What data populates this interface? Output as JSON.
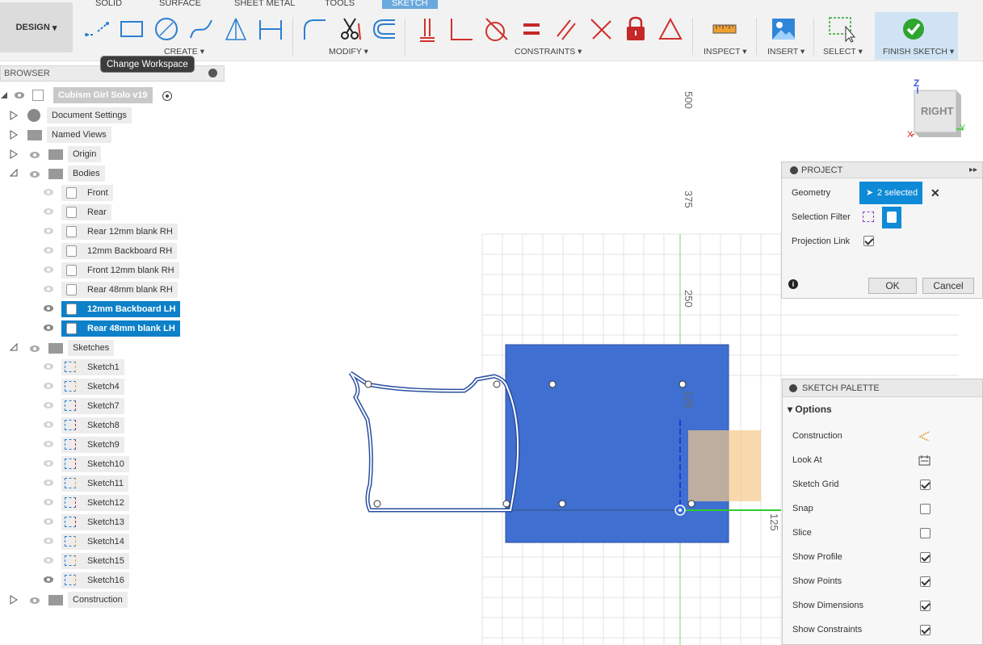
{
  "toolbar": {
    "workspace_label": "DESIGN",
    "tabs": [
      "SOLID",
      "SURFACE",
      "SHEET METAL",
      "TOOLS",
      "SKETCH"
    ],
    "groups": {
      "create": "CREATE",
      "modify": "MODIFY",
      "constraints": "CONSTRAINTS",
      "inspect": "INSPECT",
      "insert": "INSERT",
      "select": "SELECT",
      "finish": "FINISH SKETCH"
    },
    "tooltip": "Change Workspace"
  },
  "browser": {
    "header": "BROWSER",
    "root": "Cubism Girl Solo v19",
    "items": [
      {
        "label": "Document Settings",
        "kind": "settings"
      },
      {
        "label": "Named Views",
        "kind": "folder"
      },
      {
        "label": "Origin",
        "kind": "folder"
      },
      {
        "label": "Bodies",
        "kind": "folder"
      }
    ],
    "bodies": [
      {
        "label": "Front",
        "selected": false
      },
      {
        "label": "Rear",
        "selected": false
      },
      {
        "label": "Rear 12mm blank RH",
        "selected": false
      },
      {
        "label": "12mm Backboard RH",
        "selected": false
      },
      {
        "label": "Front 12mm blank RH",
        "selected": false
      },
      {
        "label": "Rear 48mm blank RH",
        "selected": false
      },
      {
        "label": "12mm Backboard LH",
        "selected": true
      },
      {
        "label": "Rear 48mm blank LH",
        "selected": true
      }
    ],
    "sketches_label": "Sketches",
    "sketches": [
      "Sketch1",
      "Sketch4",
      "Sketch7",
      "Sketch8",
      "Sketch9",
      "Sketch10",
      "Sketch11",
      "Sketch12",
      "Sketch13",
      "Sketch14",
      "Sketch15",
      "Sketch16"
    ],
    "construction_label": "Construction"
  },
  "viewport": {
    "ruler_labels": [
      "500",
      "375",
      "250",
      "125",
      "125"
    ],
    "viewcube_face": "RIGHT",
    "axis_z": "Z",
    "axis_y": "Y",
    "axis_x": "X"
  },
  "project_panel": {
    "title": "PROJECT",
    "geometry_label": "Geometry",
    "geometry_value": "2 selected",
    "selection_filter_label": "Selection Filter",
    "projection_link_label": "Projection Link",
    "ok": "OK",
    "cancel": "Cancel"
  },
  "sketch_palette": {
    "title": "SKETCH PALETTE",
    "section": "Options",
    "options": [
      {
        "label": "Construction",
        "type": "icon"
      },
      {
        "label": "Look At",
        "type": "icon"
      },
      {
        "label": "Sketch Grid",
        "type": "check",
        "checked": true
      },
      {
        "label": "Snap",
        "type": "check",
        "checked": false
      },
      {
        "label": "Slice",
        "type": "check",
        "checked": false
      },
      {
        "label": "Show Profile",
        "type": "check",
        "checked": true
      },
      {
        "label": "Show Points",
        "type": "check",
        "checked": true
      },
      {
        "label": "Show Dimensions",
        "type": "check",
        "checked": true
      },
      {
        "label": "Show Constraints",
        "type": "check",
        "checked": true
      }
    ]
  },
  "colors": {
    "accent": "#0c80c8",
    "body_fill": "#3f6fd0",
    "constraint_red": "#d0302c",
    "finish_green": "#2ea52e"
  }
}
